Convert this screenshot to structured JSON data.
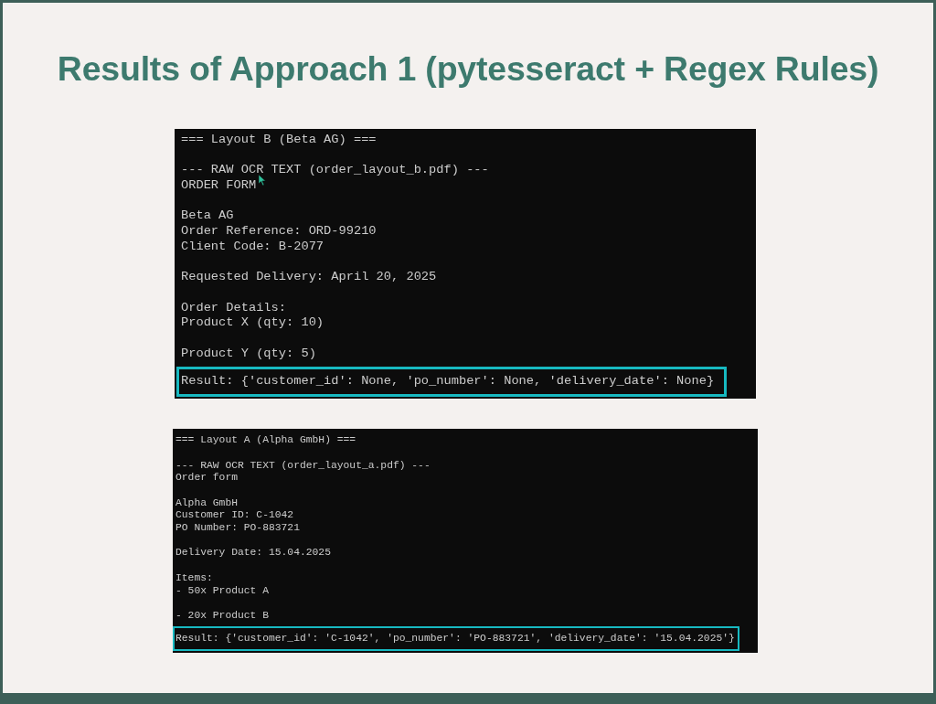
{
  "slide": {
    "title": "Results of Approach 1 (pytesseract + Regex Rules)"
  },
  "terminals": [
    {
      "cursor": true,
      "groups": [
        [
          "=== Layout B (Beta AG) ==="
        ],
        [
          "--- RAW OCR TEXT (order_layout_b.pdf) ---",
          "ORDER FORM"
        ],
        [
          "Beta AG",
          "Order Reference: ORD-99210",
          "Client Code: B-2077"
        ],
        [
          "Requested Delivery: April 20, 2025"
        ],
        [
          "Order Details:",
          "Product X (qty: 10)"
        ],
        [
          "Product Y (qty: 5)"
        ]
      ],
      "result": {
        "text": "Result: {'customer_id': None, 'po_number': None, 'delivery_date': None}",
        "highlighted": true
      }
    },
    {
      "groups": [
        [
          "=== Layout A (Alpha GmbH) ==="
        ],
        [
          "--- RAW OCR TEXT (order_layout_a.pdf) ---",
          "Order form"
        ],
        [
          "Alpha GmbH",
          "Customer ID: C-1042",
          "PO Number: PO-883721"
        ],
        [
          "Delivery Date: 15.04.2025"
        ],
        [
          "Items:",
          "- 50x Product A"
        ],
        [
          "- 20x Product B"
        ]
      ],
      "result": {
        "text": "Result: {'customer_id': 'C-1042', 'po_number': 'PO-883721', 'delivery_date': '15.04.2025'}",
        "highlighted": true
      }
    }
  ]
}
